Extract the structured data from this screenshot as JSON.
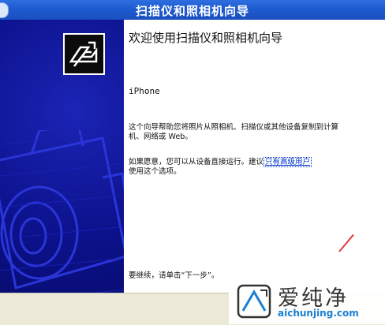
{
  "window": {
    "title": "扫描仪和照相机向导"
  },
  "wizard": {
    "heading": "欢迎使用扫描仪和照相机向导",
    "device_name": "iPhone",
    "description_line1": "这个向导帮助您将照片从照相机、扫描仪或其他设备复制到计算",
    "description_line2": "机、网络或 Web。",
    "advanced_text_line1": "如果愿意，您可以从设备直接运行。建议",
    "advanced_link": "只有高级用户",
    "advanced_text_line2": "使用这个选项。",
    "continue_text": "要继续，请单击“下一步”。"
  },
  "watermark": {
    "title": "爱纯净",
    "url": "aichunjing.com"
  },
  "colors": {
    "titlebar": "#1f5bd0",
    "side_panel": "#0c128c",
    "link": "#0033cc",
    "watermark_url": "#1a7fd4"
  },
  "icons": [
    "system-menu-icon",
    "wizard-icon",
    "camera-illustration-icon",
    "watermark-logo-icon"
  ]
}
